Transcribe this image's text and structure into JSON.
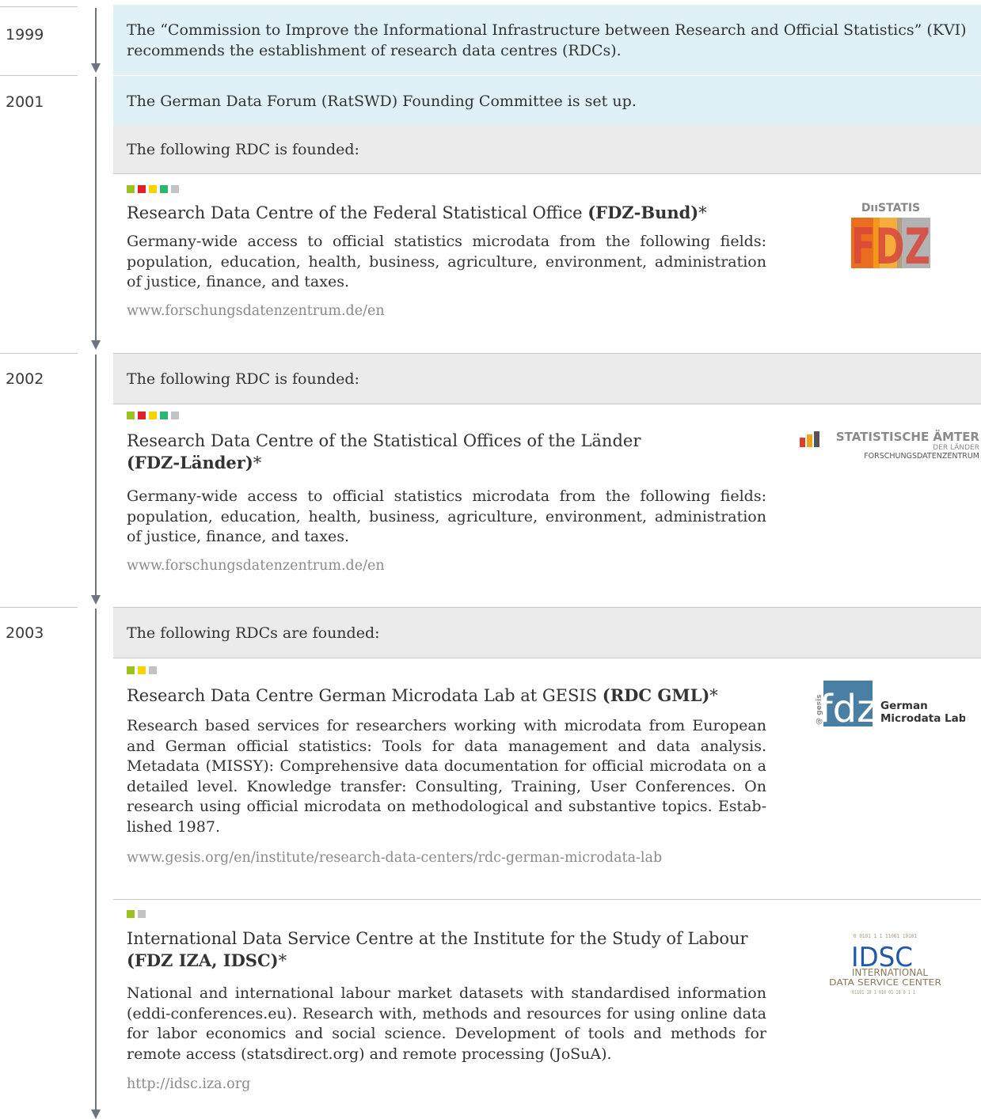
{
  "years": [
    "1999",
    "2001",
    "2002",
    "2003"
  ],
  "bands": {
    "kvi": "The “Commission to Improve the Informational Infrastructure between Research and Official Statistics” (KVI) recommends the establishment of research data centres (RDCs).",
    "ratswd": "The German Data Forum (RatSWD) Founding Committee is set up.",
    "founded_2001": "The following RDC is founded:",
    "founded_2002": "The following RDC is founded:",
    "founded_2003": "The following RDCs are founded:"
  },
  "entries": [
    {
      "title": "Research Data Centre of the Federal Statistical Office ",
      "abbr": "(FDZ-Bund)",
      "star": "*",
      "desc": "Germany-wide access to official statistics microdata from the following fields: population, education, health, business, agriculture, environment, administration of justice, finance, and taxes.",
      "link": "www.forschungsdatenzentrum.de/en",
      "squares": [
        "#9bc21e",
        "#e2202b",
        "#f5d400",
        "#2bb673",
        "#c3c3c3"
      ]
    },
    {
      "title": "Research Data Centre of the Statistical Offices of the Länder",
      "abbr": "(FDZ-Länder)",
      "star": "*",
      "desc": "Germany-wide access to official statistics microdata from the following fields: population, education, health, business, agriculture, environment, administration of justice, finance, and taxes.",
      "link": "www.forschungsdatenzentrum.de/en",
      "squares": [
        "#9bc21e",
        "#e2202b",
        "#f5d400",
        "#2bb673",
        "#c3c3c3"
      ]
    },
    {
      "title": "Research Data Centre German Microdata Lab at GESIS ",
      "abbr": "(RDC GML)",
      "star": "*",
      "desc": "Research based services for researchers working with microdata from European and German official statistics: Tools for data management and data analysis. Metadata (MISSY): Comprehensive data documentation for official microdata on a detailed level. Knowledge transfer: Consulting, Training, User Conferences. On research using official microdata on methodological and substantive topics. Estab­lished 1987.",
      "link": "www.gesis.org/en/institute/research-data-centers/rdc-german-microdata-lab",
      "squares": [
        "#9bc21e",
        "#f5d400",
        "#c3c3c3"
      ]
    },
    {
      "title": "International Data Service Centre at the Institute for the Study of Labour",
      "abbr": "(FDZ IZA, IDSC)",
      "star": "*",
      "desc": "National and international labour market datasets with standardised information (eddi-conferences.eu). Research with, methods and resources for using online data for labor economics and social science. Development of tools and methods for remote access (statsdirect.org) and remote processing (JoSuA).",
      "link": "http://idsc.iza.org",
      "squares": [
        "#9bc21e",
        "#c3c3c3"
      ]
    }
  ],
  "logos": {
    "destatis": {
      "top": "DııSTATIS",
      "main": "FDZ"
    },
    "laender": {
      "line1": "STATISTISCHE ÄMTER",
      "line2": "DER LÄNDER",
      "line3": "FORSCHUNGSDATENZENTRUM"
    },
    "gml": {
      "side": "@ gesis",
      "mark": "fdz",
      "line1": "German",
      "line2": "Microdata Lab"
    },
    "idsc": {
      "bits_top": "0  0101 1 1  11001 10101",
      "mark": "IDSC",
      "line1": "INTERNATIONAL",
      "line2": "DATA SERVICE CENTER",
      "bits_bottom": "01101 10 1 010  01 10 0  1   1"
    }
  },
  "colors": {
    "timeline": "#6e7580",
    "band_blue": "#dff0f7",
    "band_grey": "#ebebeb",
    "gml_blue": "#4a7fa3",
    "idsc_blue": "#1f5aa6",
    "idsc_brown": "#8a7a5c"
  }
}
